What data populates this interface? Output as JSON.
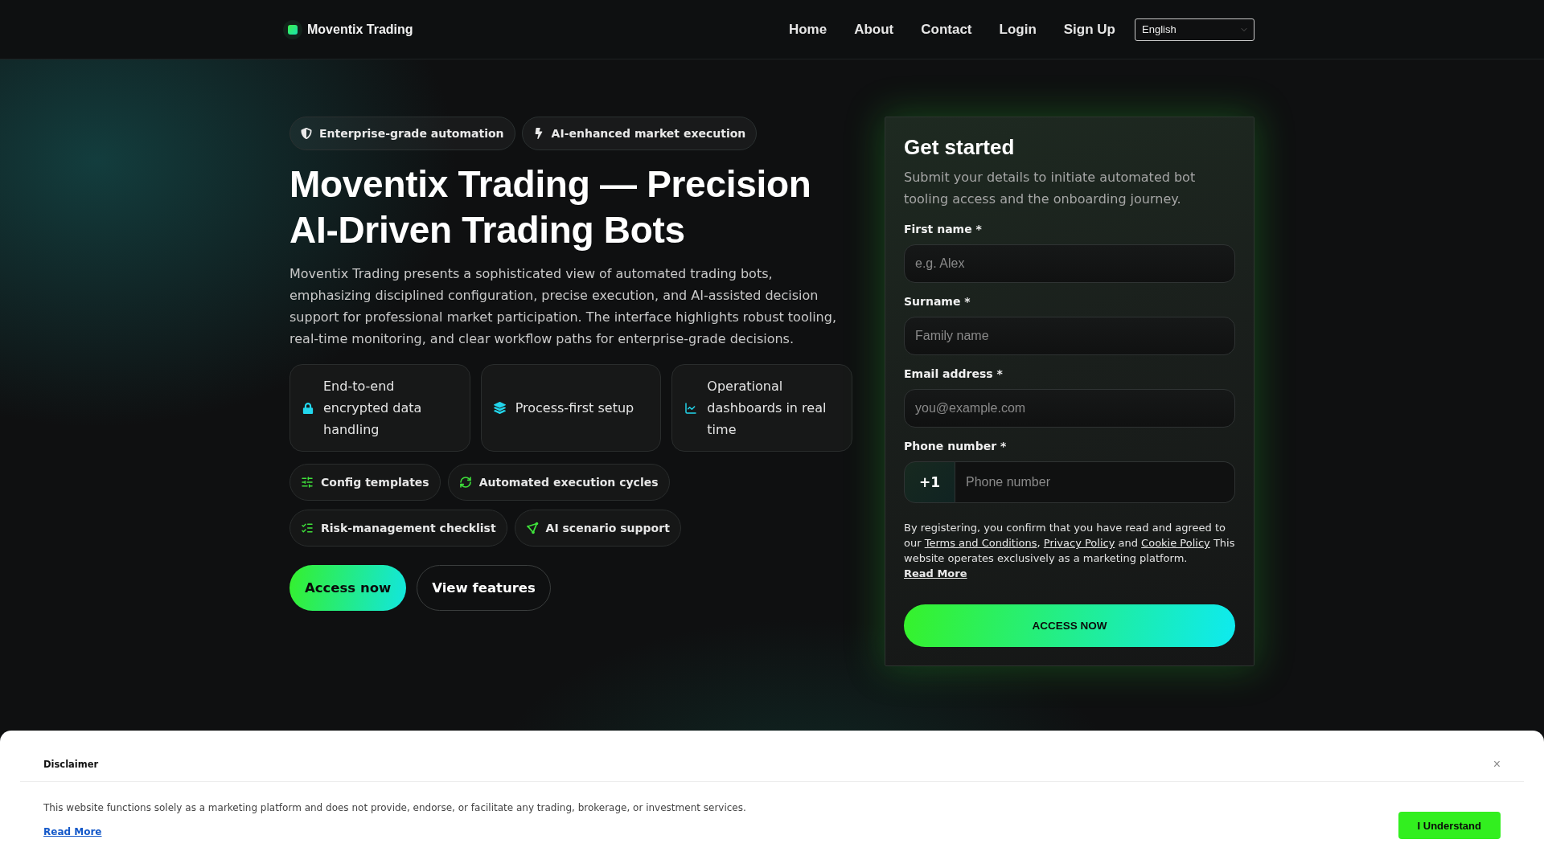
{
  "header": {
    "brand": "Moventix Trading",
    "nav": [
      "Home",
      "About",
      "Contact",
      "Login",
      "Sign Up"
    ],
    "language": "English"
  },
  "hero": {
    "badges": [
      "Enterprise-grade automation",
      "AI-enhanced market execution"
    ],
    "title": "Moventix Trading — Precision AI-Driven Trading Bots",
    "description": "Moventix Trading presents a sophisticated view of automated trading bots, emphasizing disciplined configuration, precise execution, and AI-assisted decision support for professional market participation. The interface highlights robust tooling, real-time monitoring, and clear workflow paths for enterprise-grade decisions.",
    "features": [
      "End-to-end encrypted data handling",
      "Process-first setup",
      "Operational dashboards in real time"
    ],
    "tools": [
      "Config templates",
      "Automated execution cycles",
      "Risk-management checklist",
      "AI scenario support"
    ],
    "buttons": [
      {
        "label": "Access now",
        "kind": "primary"
      },
      {
        "label": "View features",
        "kind": "secondary"
      }
    ]
  },
  "form": {
    "title": "Get started",
    "subtitle": "Submit your details to initiate automated bot tooling access and the onboarding journey.",
    "fields": [
      {
        "kind": "text",
        "label": "First name *",
        "placeholder": "e.g. Alex"
      },
      {
        "kind": "text",
        "label": "Surname *",
        "placeholder": "Family name"
      },
      {
        "kind": "email",
        "label": "Email address *",
        "placeholder": "you@example.com"
      },
      {
        "kind": "phone",
        "label": "Phone number *",
        "prefix": "+1",
        "placeholder": "Phone number"
      }
    ],
    "consent": [
      {
        "kind": "text",
        "text": "By registering, you confirm that you have read and agreed to our "
      },
      {
        "kind": "link",
        "text": "Terms and Conditions"
      },
      {
        "kind": "text",
        "text": ", "
      },
      {
        "kind": "link",
        "text": "Privacy Policy"
      },
      {
        "kind": "text",
        "text": " and "
      },
      {
        "kind": "link",
        "text": "Cookie Policy"
      },
      {
        "kind": "text",
        "text": " This website operates exclusively as a marketing platform. "
      },
      {
        "kind": "strong_link",
        "text": "Read More"
      }
    ],
    "submit": "ACCESS NOW"
  },
  "disclaimer": {
    "title": "Disclaimer",
    "close": "×",
    "text": "This website functions solely as a marketing platform and does not provide, endorse, or facilitate any trading, brokerage, or investment services.",
    "link": "Read More",
    "button": "I Understand"
  }
}
